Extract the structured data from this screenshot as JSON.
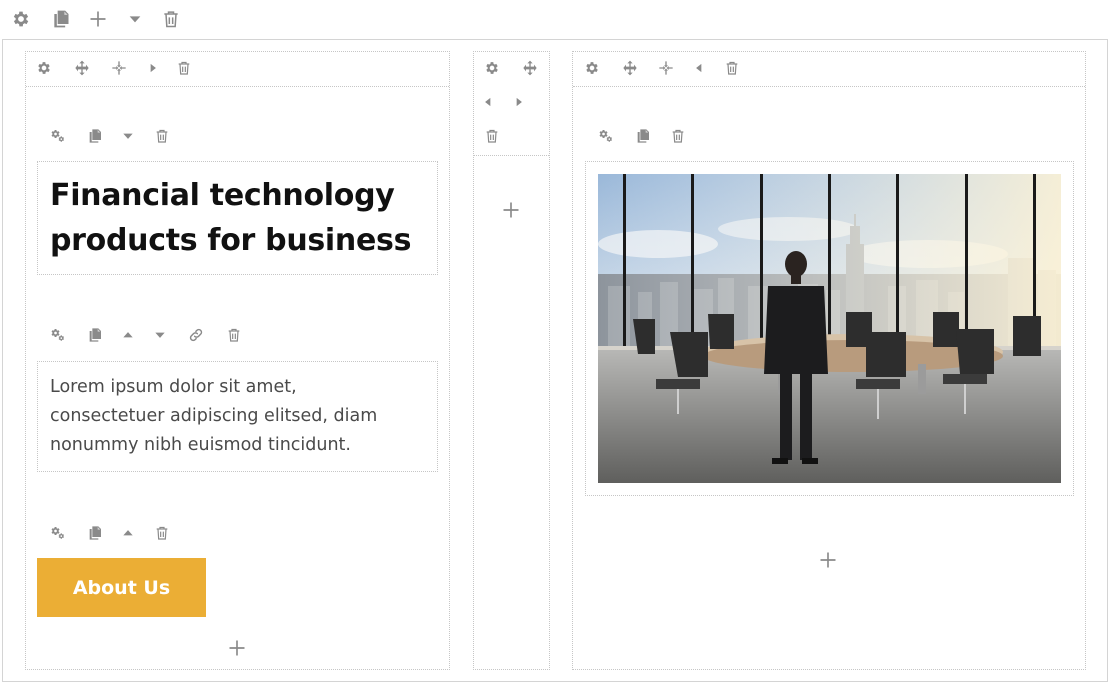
{
  "heading": {
    "line1": "Financial technology",
    "line2": "products for business"
  },
  "text_block": {
    "line1": "Lorem ipsum dolor sit amet,",
    "line2": "consectetuer adipiscing elitsed, diam",
    "line3": "nonummy nibh euismod tincidunt."
  },
  "button": {
    "label": "About Us",
    "color": "#ebae35"
  },
  "colors": {
    "icon": "#8a8a8a",
    "border": "#c6c6c6"
  },
  "image": {
    "subject": "businessman in conference room overlooking city skyline"
  }
}
